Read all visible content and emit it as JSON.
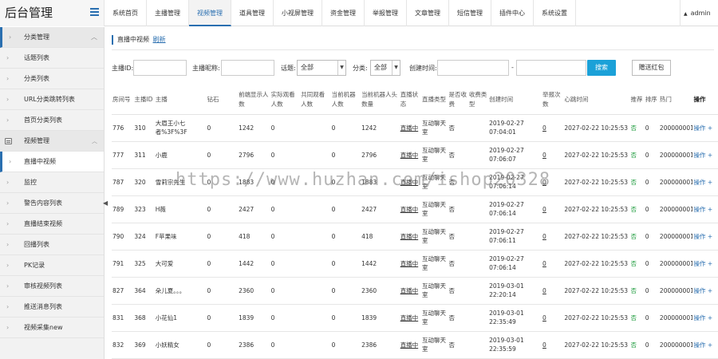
{
  "app": {
    "title": "后台管理",
    "user": "admin"
  },
  "nav": {
    "tabs": [
      "系统首页",
      "主播管理",
      "视频管理",
      "道具管理",
      "小视屏管理",
      "资金管理",
      "举报管理",
      "文章管理",
      "短信管理",
      "插件中心",
      "系统设置"
    ],
    "active_index": 2
  },
  "sidebar": {
    "items": [
      {
        "label": "分类管理",
        "kind": "first"
      },
      {
        "label": "话题列表",
        "kind": "item"
      },
      {
        "label": "分类列表",
        "kind": "item"
      },
      {
        "label": "URL分类跳转列表",
        "kind": "item"
      },
      {
        "label": "首页分类列表",
        "kind": "item"
      },
      {
        "label": "视频管理",
        "kind": "group"
      },
      {
        "label": "直播中视频",
        "kind": "active"
      },
      {
        "label": "监控",
        "kind": "item"
      },
      {
        "label": "警告内容列表",
        "kind": "item"
      },
      {
        "label": "直播结束视频",
        "kind": "item"
      },
      {
        "label": "回播列表",
        "kind": "item"
      },
      {
        "label": "PK记录",
        "kind": "item"
      },
      {
        "label": "审核视频列表",
        "kind": "item"
      },
      {
        "label": "推送消息列表",
        "kind": "item"
      },
      {
        "label": "视频采集new",
        "kind": "item"
      }
    ]
  },
  "breadcrumb": {
    "label": "直播中视频",
    "refresh": "刷新"
  },
  "filters": {
    "anchor_id_label": "主播ID:",
    "anchor_name_label": "主播昵称:",
    "topic_label": "话题:",
    "topic_value": "全部",
    "category_label": "分类:",
    "category_value": "全部",
    "created_label": "创建时间:",
    "dash": "-",
    "search_button": "搜索",
    "gift_button": "赠送红包"
  },
  "table": {
    "headers": [
      "房间号",
      "主播ID",
      "主播",
      "钻石",
      "前端显示人数",
      "实际观看人数",
      "共同观看人数",
      "当前机器人数",
      "当前机器人头数量",
      "直播状态",
      "直播类型",
      "是否收费",
      "收费类型",
      "创建时间",
      "举报次数",
      "心跳时间",
      "推荐",
      "排序",
      "热门",
      "操作"
    ],
    "rows": [
      [
        "776",
        "310",
        "大眉王小七者%3F%3F",
        "0",
        "1242",
        "0",
        "",
        "0",
        "1242",
        "直播中",
        "互动聊天室",
        "否",
        "",
        "2019-02-27 07:04:01",
        "0",
        "2027-02-22 10:25:53",
        "否",
        "0",
        "200000001",
        "操作 +"
      ],
      [
        "777",
        "311",
        "小鹿",
        "0",
        "2796",
        "0",
        "",
        "0",
        "2796",
        "直播中",
        "互动聊天室",
        "否",
        "",
        "2019-02-27 07:06:07",
        "0",
        "2027-02-22 10:25:53",
        "否",
        "0",
        "200000001",
        "操作 +"
      ],
      [
        "787",
        "320",
        "雪莉宗先生",
        "0",
        "1883",
        "0",
        "",
        "0",
        "1883",
        "直播中",
        "互动聊天室",
        "否",
        "",
        "2019-02-27 07:06:14",
        "0",
        "2027-02-22 10:25:53",
        "否",
        "0",
        "200000001",
        "操作 +"
      ],
      [
        "789",
        "323",
        "H薇",
        "0",
        "2427",
        "0",
        "",
        "0",
        "2427",
        "直播中",
        "互动聊天室",
        "否",
        "",
        "2019-02-27 07:06:14",
        "0",
        "2027-02-22 10:25:53",
        "否",
        "0",
        "200000001",
        "操作 +"
      ],
      [
        "790",
        "324",
        "F苹果味",
        "0",
        "418",
        "0",
        "",
        "0",
        "418",
        "直播中",
        "互动聊天室",
        "否",
        "",
        "2019-02-27 07:06:11",
        "0",
        "2027-02-22 10:25:53",
        "否",
        "0",
        "200000001",
        "操作 +"
      ],
      [
        "791",
        "325",
        "大可爱",
        "0",
        "1442",
        "0",
        "",
        "0",
        "1442",
        "直播中",
        "互动聊天室",
        "否",
        "",
        "2019-02-27 07:06:14",
        "0",
        "2027-02-22 10:25:53",
        "否",
        "0",
        "200000001",
        "操作 +"
      ],
      [
        "827",
        "364",
        "朵儿夏。。。",
        "0",
        "2360",
        "0",
        "",
        "0",
        "2360",
        "直播中",
        "互动聊天室",
        "否",
        "",
        "2019-03-01 22:20:14",
        "0",
        "2027-02-22 10:25:53",
        "否",
        "0",
        "200000001",
        "操作 +"
      ],
      [
        "831",
        "368",
        "小花仙1",
        "0",
        "1839",
        "0",
        "",
        "0",
        "1839",
        "直播中",
        "互动聊天室",
        "否",
        "",
        "2019-03-01 22:35:49",
        "0",
        "2027-02-22 10:25:53",
        "否",
        "0",
        "200000001",
        "操作 +"
      ],
      [
        "832",
        "369",
        "小妖精女",
        "0",
        "2386",
        "0",
        "",
        "0",
        "2386",
        "直播中",
        "互动聊天室",
        "否",
        "",
        "2019-03-01 22:35:59",
        "0",
        "2027-02-22 10:25:53",
        "否",
        "0",
        "200000001",
        "操作 +"
      ]
    ]
  },
  "watermark": "https://www.huzhan.com/ishop20328"
}
